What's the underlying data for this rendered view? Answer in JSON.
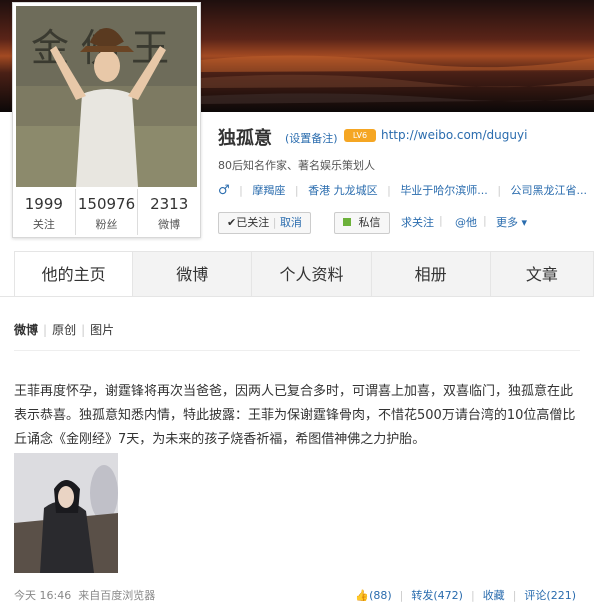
{
  "profile": {
    "name": "独孤意",
    "remark_link": "(设置备注)",
    "badge": "LV6",
    "url": "http://weibo.com/duguyi",
    "description": "80后知名作家、著名娱乐策划人",
    "gender_icon": "male-icon",
    "info": {
      "constellation": "摩羯座",
      "location": "香港 九龙城区",
      "school": "毕业于哈尔滨师...",
      "company": "公司黑龙江省..."
    },
    "stats": [
      {
        "num": "1999",
        "label": "关注"
      },
      {
        "num": "150976",
        "label": "粉丝"
      },
      {
        "num": "2313",
        "label": "微博"
      }
    ]
  },
  "actions": {
    "followed": "✔已关注",
    "cancel": "取消",
    "message": "私信",
    "seek": "求关注",
    "at": "@他",
    "more": "更多"
  },
  "tabs": [
    "他的主页",
    "微博",
    "个人资料",
    "相册",
    "文章"
  ],
  "filter": [
    "微博",
    "原创",
    "图片"
  ],
  "post": {
    "text": "王菲再度怀孕，谢霆锋将再次当爸爸，因两人已复合多时，可谓喜上加喜，双喜临门，独孤意在此表示恭喜。独孤意知悉内情，特此披露：王菲为保谢霆锋骨肉，不惜花500万请台湾的10位高僧比丘诵念《金刚经》7天，为未来的孩子烧香祈福，希图借神佛之力护胎。",
    "time": "今天 16:46",
    "source_prefix": "来自",
    "source": "百度浏览器",
    "like": "(88)",
    "repost": "转发(472)",
    "fav": "收藏",
    "comment": "评论(221)"
  }
}
